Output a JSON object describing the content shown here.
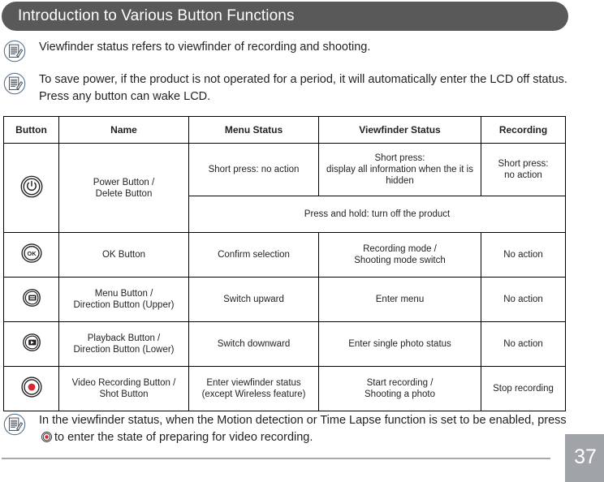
{
  "header": {
    "title": "Introduction to Various Button Functions"
  },
  "notes": [
    {
      "icon": "note-pencil-icon",
      "text": "Viewfinder status refers to viewfinder of recording and shooting."
    },
    {
      "icon": "note-pencil-icon",
      "text": "To save power, if the product is not operated for a period, it will automatically enter the LCD off status. Press any button can wake LCD."
    }
  ],
  "bottom_note": {
    "icon": "note-pencil-icon",
    "text_before": "In the viewfinder status, when the Motion detection or Time Lapse function is set to be enabled, press",
    "inline_icon": "video-record-button-icon",
    "text_after": "to enter the state of preparing for video recording."
  },
  "table": {
    "headers": [
      "Button",
      "Name",
      "Menu Status",
      "Viewfinder Status",
      "Recording"
    ],
    "rows": [
      {
        "icon": "power-button-icon",
        "name": "Power Button /\nDelete Button",
        "menu_status": "Short press: no action",
        "viewfinder_status": "Short press:\ndisplay all information when the it is hidden",
        "recording": "Short press:\nno action",
        "span_note": "Press and hold: turn off the product"
      },
      {
        "icon": "ok-button-icon",
        "name": "OK Button",
        "menu_status": "Confirm selection",
        "viewfinder_status": "Recording mode /\nShooting mode switch",
        "recording": "No action"
      },
      {
        "icon": "menu-button-icon",
        "name": "Menu Button /\nDirection Button (Upper)",
        "menu_status": "Switch upward",
        "viewfinder_status": "Enter menu",
        "recording": "No action"
      },
      {
        "icon": "playback-button-icon",
        "name": "Playback Button /\nDirection Button (Lower)",
        "menu_status": "Switch downward",
        "viewfinder_status": "Enter single photo status",
        "recording": "No action"
      },
      {
        "icon": "video-record-button-icon",
        "name": "Video Recording Button /\nShot Button",
        "menu_status": "Enter viewfinder status\n(except Wireless feature)",
        "viewfinder_status": "Start recording /\nShooting a photo",
        "recording": "Stop recording"
      }
    ]
  },
  "footer": {
    "page_number": "37"
  },
  "colors": {
    "header_bar": "#595959",
    "page_box": "#a0a4a8",
    "rule": "#a7a9ac",
    "record_red": "#d7282f",
    "note_icon_outline": "#5b7490",
    "table_border": "#000000"
  }
}
